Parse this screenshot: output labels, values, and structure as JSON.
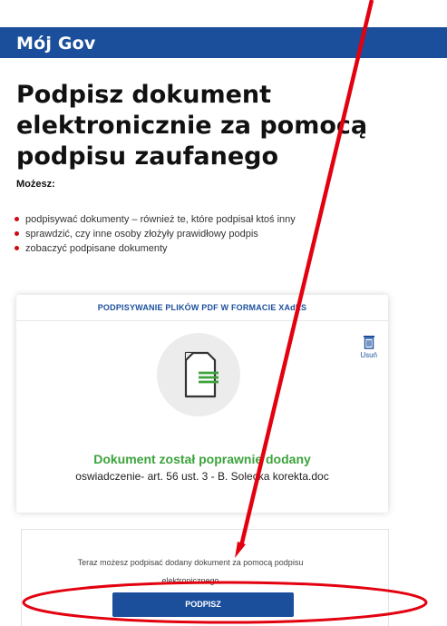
{
  "header": {
    "brand": "Mój Gov"
  },
  "main": {
    "title": "Podpisz dokument elektronicznie za pomocą podpisu zaufanego",
    "lead": "Możesz:",
    "bullets": [
      "podpisywać dokumenty – również te, które podpisał ktoś inny",
      "sprawdzić, czy inne osoby złożyły prawidłowy podpis",
      "zobaczyć podpisane dokumenty"
    ]
  },
  "card": {
    "heading": "PODPISYWANIE PLIKÓW PDF W FORMACIE XAdES",
    "delete_label": "Usuń",
    "status": "Dokument został poprawnie dodany",
    "filename": "oswiadczenie- art. 56 ust. 3 - B. Solecka korekta.doc"
  },
  "sign": {
    "text": "Teraz możesz podpisać dodany dokument za pomocą podpisu elektronicznego",
    "button_label": "PODPISZ"
  },
  "colors": {
    "brand_blue": "#1b4f9c",
    "success_green": "#3ca33c",
    "bullet_red": "#d10a11",
    "annotation_red": "#e3000f"
  }
}
